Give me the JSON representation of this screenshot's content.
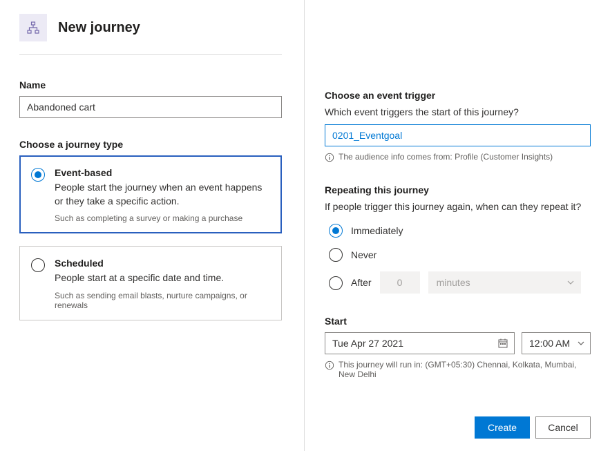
{
  "header": {
    "title": "New journey",
    "icon": "hierarchy-icon"
  },
  "name": {
    "label": "Name",
    "value": "Abandoned cart"
  },
  "journeyType": {
    "label": "Choose a journey type",
    "options": [
      {
        "title": "Event-based",
        "desc": "People start the journey when an event happens or they take a specific action.",
        "hint": "Such as completing a survey or making a purchase",
        "selected": true
      },
      {
        "title": "Scheduled",
        "desc": "People start at a specific date and time.",
        "hint": "Such as sending email blasts, nurture campaigns, or renewals",
        "selected": false
      }
    ]
  },
  "trigger": {
    "label": "Choose an event trigger",
    "sub": "Which event triggers the start of this journey?",
    "value": "0201_Eventgoal",
    "info": "The audience info comes from: Profile (Customer Insights)"
  },
  "repeat": {
    "label": "Repeating this journey",
    "sub": "If people trigger this journey again, when can they repeat it?",
    "options": {
      "immediately": "Immediately",
      "never": "Never",
      "after": "After"
    },
    "afterValue": "0",
    "afterUnit": "minutes",
    "selected": "immediately"
  },
  "start": {
    "label": "Start",
    "date": "Tue Apr 27 2021",
    "time": "12:00 AM",
    "tz": "This journey will run in: (GMT+05:30) Chennai, Kolkata, Mumbai, New Delhi"
  },
  "footer": {
    "create": "Create",
    "cancel": "Cancel"
  }
}
